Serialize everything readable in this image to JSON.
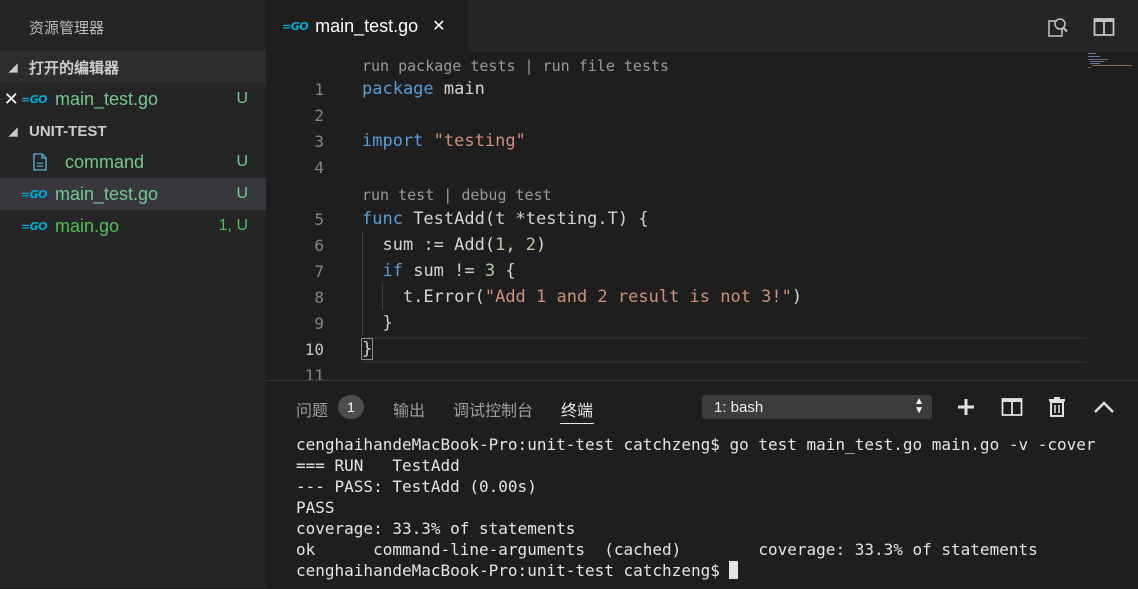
{
  "sidebar": {
    "title": "资源管理器",
    "open_editors": {
      "header": "打开的编辑器",
      "items": [
        {
          "name": "main_test.go",
          "icon": "go-icon",
          "status": "U"
        }
      ]
    },
    "workspace": {
      "header": "UNIT-TEST",
      "items": [
        {
          "name": "command",
          "icon": "file-icon",
          "status": "U"
        },
        {
          "name": "main_test.go",
          "icon": "go-icon",
          "status": "U"
        },
        {
          "name": "main.go",
          "icon": "go-icon",
          "status": "1, U"
        }
      ]
    }
  },
  "tabs": [
    {
      "label": "main_test.go",
      "icon": "go-icon"
    }
  ],
  "editor": {
    "codelens_top": "run package tests | run file tests",
    "codelens_func": "run test | debug test",
    "line_numbers": [
      "1",
      "2",
      "3",
      "4",
      "5",
      "6",
      "7",
      "8",
      "9",
      "10",
      "11"
    ],
    "active_line": "10",
    "code": {
      "l1_kw": "package",
      "l1_rest": " main",
      "l3_kw": "import",
      "l3_str": "\"testing\"",
      "l5_kw": "func",
      "l5_rest": " TestAdd(t *testing.T) {",
      "l6_pre": "  sum := Add(",
      "l6_n1": "1",
      "l6_mid": ", ",
      "l6_n2": "2",
      "l6_post": ")",
      "l7_kw": "if",
      "l7_rest": " sum != ",
      "l7_num": "3",
      "l7_post": " {",
      "l8_pre": "t.Error(",
      "l8_str": "\"Add 1 and 2 result is not 3!\"",
      "l8_post": ")",
      "l9": "}",
      "l10": "}"
    }
  },
  "panel": {
    "tabs": [
      "问题",
      "输出",
      "调试控制台",
      "终端"
    ],
    "active_tab": "终端",
    "problems_count": "1",
    "terminal_select": "1: bash",
    "terminal_lines": [
      "cenghaihandeMacBook-Pro:unit-test catchzeng$ go test main_test.go main.go -v -cover",
      "=== RUN   TestAdd",
      "--- PASS: TestAdd (0.00s)",
      "PASS",
      "coverage: 33.3% of statements",
      "ok      command-line-arguments  (cached)        coverage: 33.3% of statements",
      "cenghaihandeMacBook-Pro:unit-test catchzeng$ "
    ]
  },
  "colors": {
    "accent_green": "#73c991",
    "go_blue": "#00acd7",
    "keyword": "#569cd6",
    "string": "#ce9178",
    "number": "#b5cea8"
  }
}
